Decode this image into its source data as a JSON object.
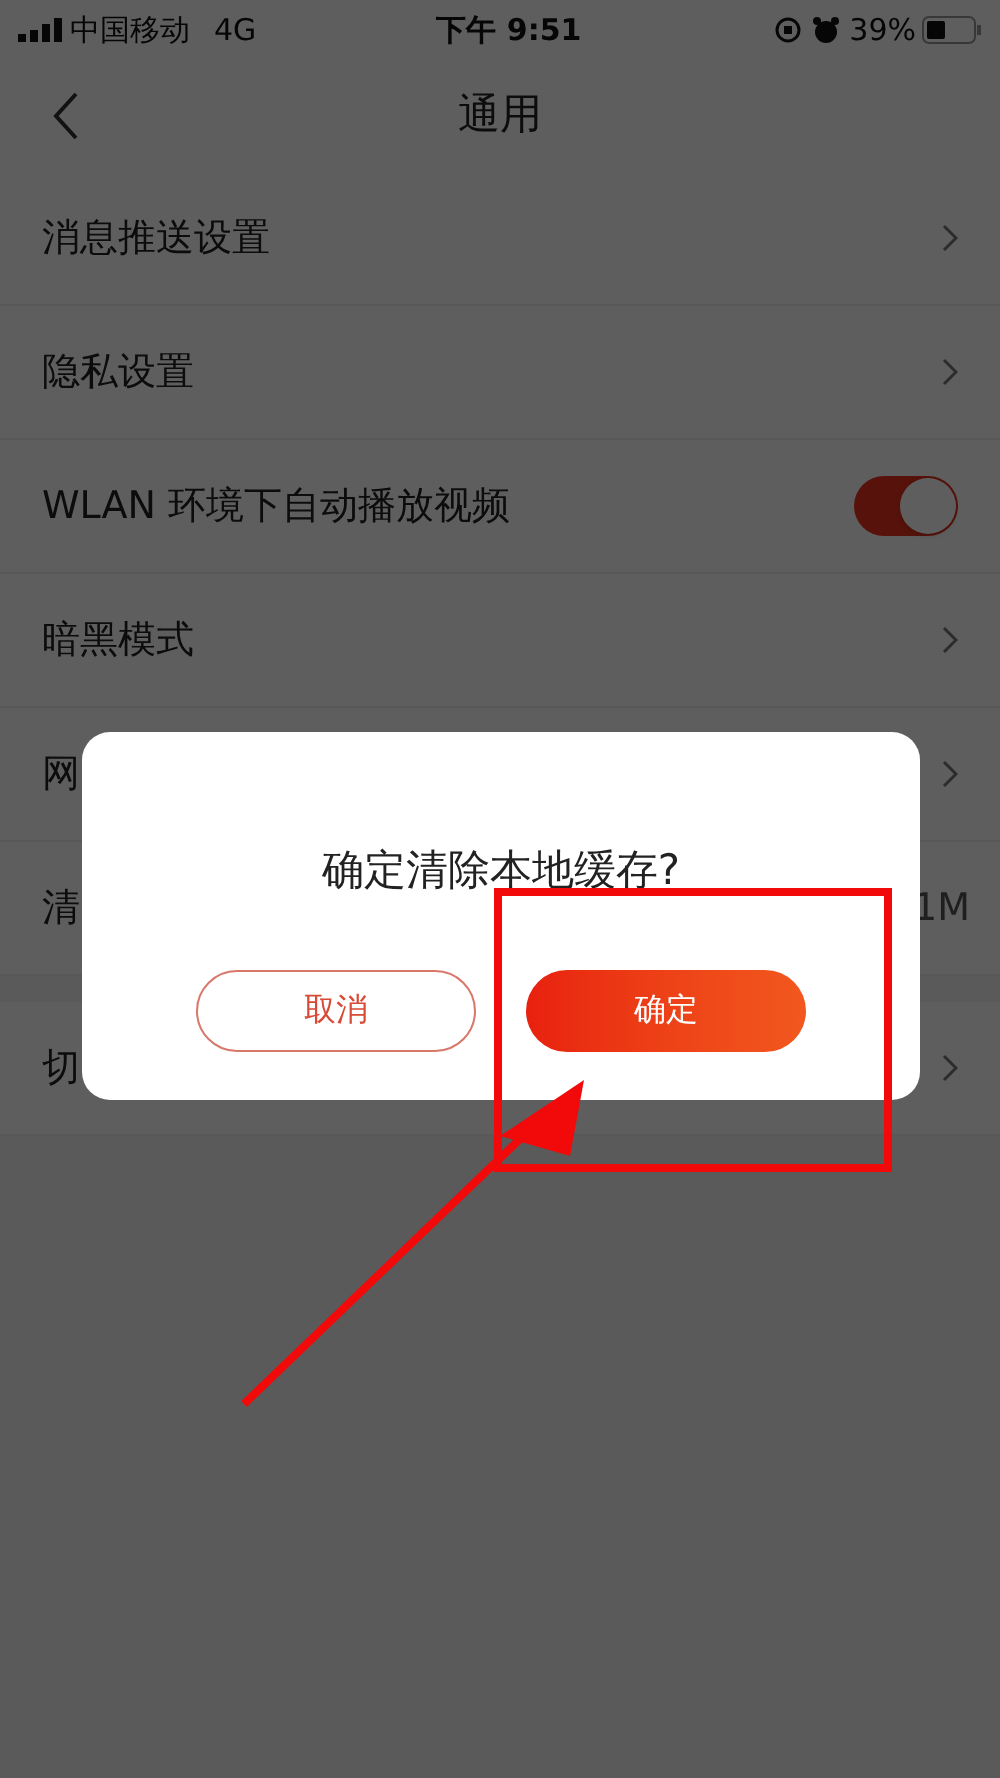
{
  "status_bar": {
    "carrier": "中国移动",
    "network": "4G",
    "time": "下午 9:51",
    "battery": "39%"
  },
  "header": {
    "title": "通用"
  },
  "rows": [
    {
      "label": "消息推送设置",
      "kind": "chevron"
    },
    {
      "label": "隐私设置",
      "kind": "chevron"
    },
    {
      "label": "WLAN 环境下自动播放视频",
      "kind": "toggle",
      "on": true
    },
    {
      "label": "暗黑模式",
      "kind": "chevron"
    },
    {
      "label": "网",
      "kind": "chevron"
    },
    {
      "label": "清",
      "kind": "value",
      "value": "1M"
    },
    {
      "label": "切",
      "kind": "chevron"
    }
  ],
  "dialog": {
    "message": "确定清除本地缓存?",
    "cancel": "取消",
    "confirm": "确定"
  }
}
